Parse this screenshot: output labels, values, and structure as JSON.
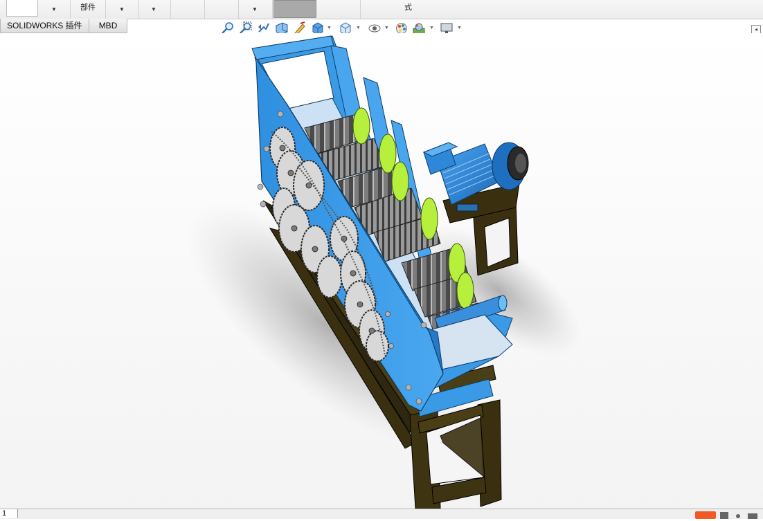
{
  "ribbon": {
    "seg1_line1": "",
    "seg3_line1": "",
    "seg3_line2": "部件",
    "seg6_label": "",
    "seg7_label": "",
    "seg9_label": "",
    "seg10_line1": "",
    "seg10_line2": "式"
  },
  "tabs": [
    {
      "label": "SOLIDWORKS 插件"
    },
    {
      "label": "MBD"
    }
  ],
  "sheet": {
    "number": "1"
  },
  "icons": {
    "zoom_fit": "zoom-to-fit-icon",
    "zoom_area": "zoom-to-area-icon",
    "previous_view": "previous-view-icon",
    "section_view": "section-view-icon",
    "dynamic_annotation": "dynamic-annotation-icon",
    "view_orientation": "view-orientation-icon",
    "display_style": "display-style-icon",
    "hide_show": "hide-show-items-icon",
    "edit_appearance": "edit-appearance-icon",
    "apply_scene": "apply-scene-icon",
    "view_settings": "view-settings-icon"
  },
  "colors": {
    "frame_blue": "#3f9ee8",
    "gear_green": "#b6ef3c",
    "stand_dark": "#3a3010",
    "motor_blue": "#2f87d8"
  }
}
